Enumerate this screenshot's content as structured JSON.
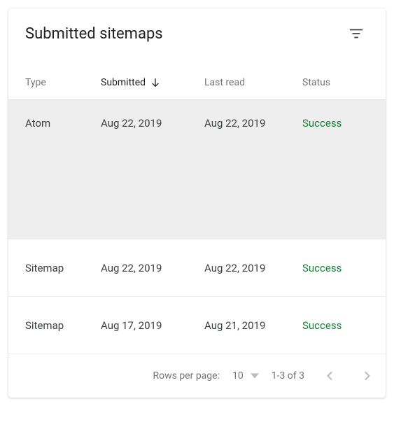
{
  "header": {
    "title": "Submitted sitemaps"
  },
  "columns": {
    "type": "Type",
    "submitted": "Submitted",
    "last_read": "Last read",
    "status": "Status"
  },
  "sort": {
    "column": "submitted",
    "direction": "desc"
  },
  "rows": [
    {
      "type": "Atom",
      "submitted": "Aug 22, 2019",
      "last_read": "Aug 22, 2019",
      "status": "Success"
    },
    {
      "type": "Sitemap",
      "submitted": "Aug 22, 2019",
      "last_read": "Aug 22, 2019",
      "status": "Success"
    },
    {
      "type": "Sitemap",
      "submitted": "Aug 17, 2019",
      "last_read": "Aug 21, 2019",
      "status": "Success"
    }
  ],
  "footer": {
    "rows_per_page_label": "Rows per page:",
    "rows_per_page_value": "10",
    "range": "1-3 of 3"
  },
  "colors": {
    "success": "#188038"
  }
}
